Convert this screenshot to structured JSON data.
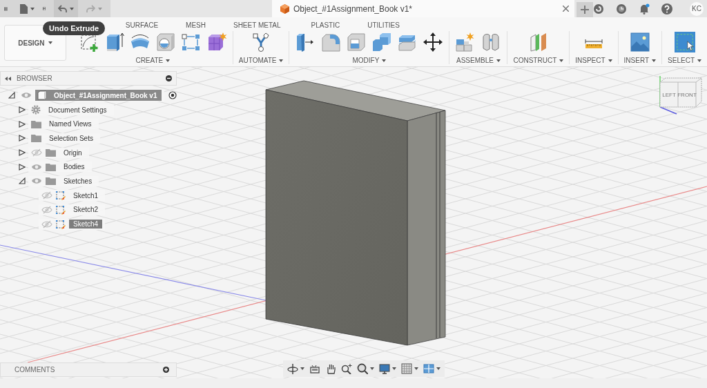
{
  "app_bar": {
    "document_tab": {
      "title": "Object_#1Assignment_Book v1*"
    },
    "user": {
      "initials": "KC"
    }
  },
  "tooltip": {
    "text": "Undo Extrude"
  },
  "workspace_menu": {
    "label": "DESIGN"
  },
  "toolbar_tabs": [
    {
      "label": "SURFACE",
      "selected": false
    },
    {
      "label": "MESH",
      "selected": false
    },
    {
      "label": "SHEET METAL",
      "selected": false
    },
    {
      "label": "PLASTIC",
      "selected": false
    },
    {
      "label": "UTILITIES",
      "selected": false
    }
  ],
  "tool_groups": [
    {
      "label": "CREATE"
    },
    {
      "label": "AUTOMATE"
    },
    {
      "label": "MODIFY"
    },
    {
      "label": "ASSEMBLE"
    },
    {
      "label": "CONSTRUCT"
    },
    {
      "label": "INSPECT"
    },
    {
      "label": "INSERT"
    },
    {
      "label": "SELECT"
    }
  ],
  "browser": {
    "title": "BROWSER",
    "tree": [
      {
        "label": "Object_#1Assignment_Book v1",
        "kind": "component",
        "expanded": true,
        "visible": true,
        "selected": true,
        "active": true,
        "children": [
          {
            "label": "Document Settings",
            "kind": "settings",
            "expanded": false,
            "selected": false
          },
          {
            "label": "Named Views",
            "kind": "folder",
            "expanded": false,
            "selected": false
          },
          {
            "label": "Selection Sets",
            "kind": "folder",
            "expanded": false,
            "selected": false
          },
          {
            "label": "Origin",
            "kind": "folder",
            "expanded": false,
            "visible": false,
            "selected": false
          },
          {
            "label": "Bodies",
            "kind": "folder",
            "expanded": false,
            "visible": true,
            "selected": false
          },
          {
            "label": "Sketches",
            "kind": "folder",
            "expanded": true,
            "visible": true,
            "selected": false,
            "children": [
              {
                "label": "Sketch1",
                "kind": "sketch",
                "visible": false,
                "selected": false
              },
              {
                "label": "Sketch2",
                "kind": "sketch",
                "visible": false,
                "selected": false
              },
              {
                "label": "Sketch4",
                "kind": "sketch",
                "visible": false,
                "selected": true
              }
            ]
          }
        ]
      }
    ]
  },
  "view_cube": {
    "faces": [
      "LEFT",
      "FRONT"
    ]
  },
  "comments": {
    "title": "COMMENTS"
  }
}
